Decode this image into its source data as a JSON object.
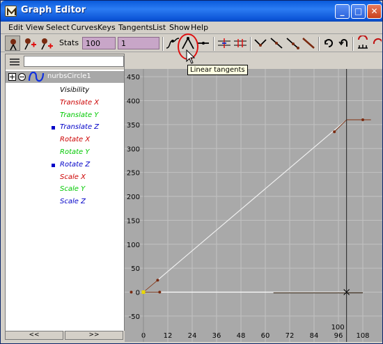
{
  "window": {
    "title": "Graph Editor",
    "controls": {
      "minimize": "_",
      "maximize": "□",
      "close": "✕"
    }
  },
  "menu": [
    "Edit",
    "View",
    "Select",
    "Curves",
    "Keys",
    "Tangents",
    "List",
    "Show",
    "Help"
  ],
  "toolbar": {
    "stats_label": "Stats",
    "field_time": "100",
    "field_value": "1",
    "tooltip": "Linear tangents"
  },
  "outliner": {
    "node": "nurbsCircle1",
    "attributes": [
      {
        "label": "Visibility",
        "color": "#000000",
        "selected": false
      },
      {
        "label": "Translate X",
        "color": "#cc0000",
        "selected": false
      },
      {
        "label": "Translate Y",
        "color": "#00c800",
        "selected": false
      },
      {
        "label": "Translate Z",
        "color": "#0000c8",
        "selected": true
      },
      {
        "label": "Rotate X",
        "color": "#cc0000",
        "selected": false
      },
      {
        "label": "Rotate Y",
        "color": "#00c800",
        "selected": false
      },
      {
        "label": "Rotate Z",
        "color": "#0000c8",
        "selected": true
      },
      {
        "label": "Scale X",
        "color": "#cc0000",
        "selected": false
      },
      {
        "label": "Scale Y",
        "color": "#00c800",
        "selected": false
      },
      {
        "label": "Scale Z",
        "color": "#0000c8",
        "selected": false
      }
    ],
    "prev_button": "<<",
    "next_button": ">>"
  },
  "graph": {
    "y_ticks": [
      "450",
      "400",
      "350",
      "300",
      "250",
      "200",
      "150",
      "100",
      "50",
      "0",
      "-50"
    ],
    "x_ticks": [
      "0",
      "12",
      "24",
      "36",
      "48",
      "60",
      "72",
      "84",
      "96",
      "108"
    ],
    "current_frame": "100"
  }
}
